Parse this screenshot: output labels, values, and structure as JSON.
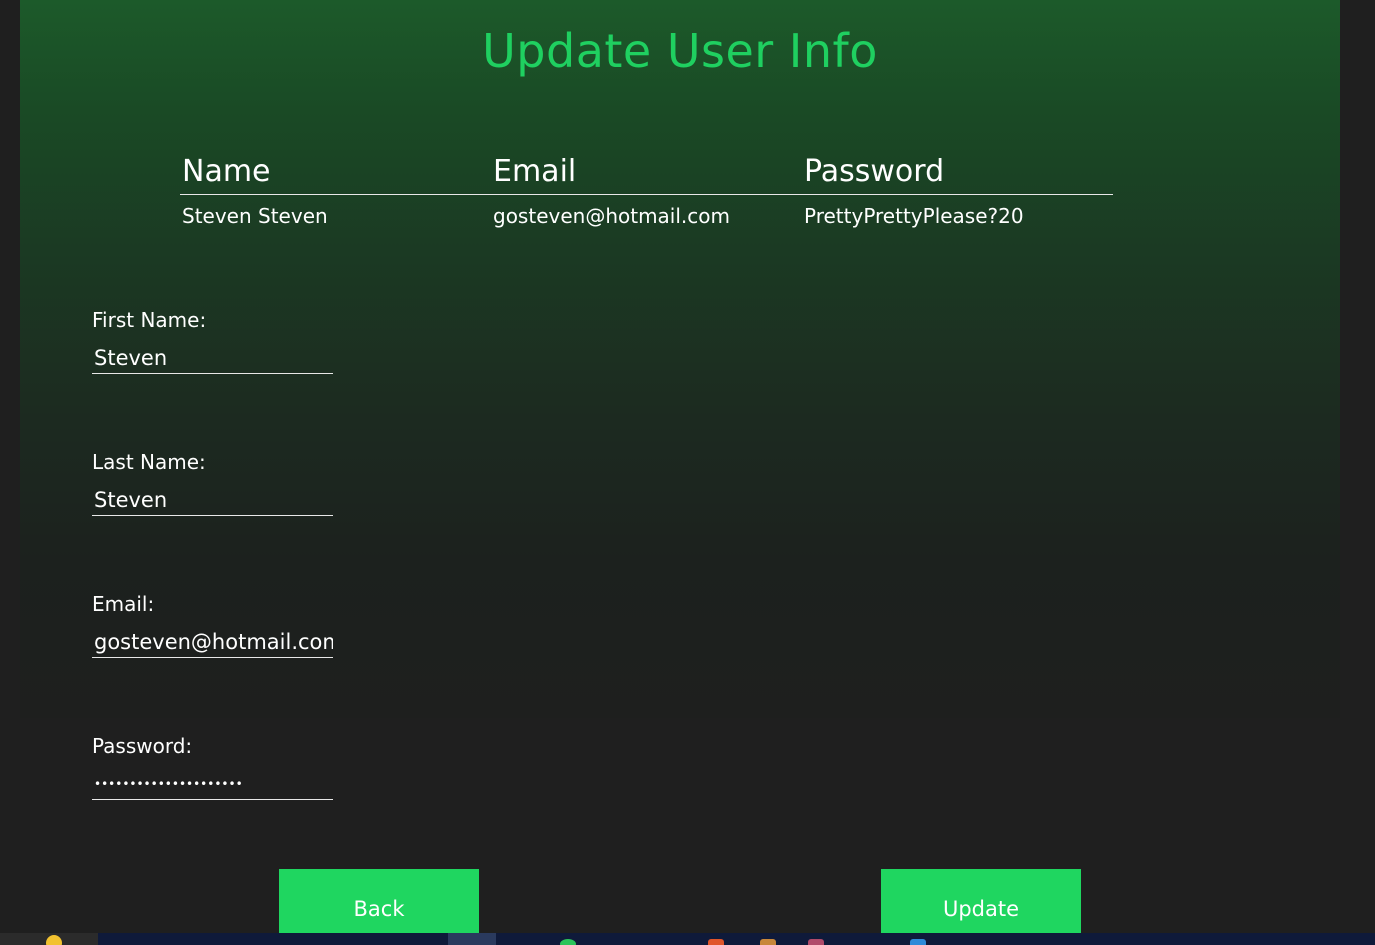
{
  "title": "Update User Info",
  "table": {
    "headers": [
      "Name",
      "Email",
      "Password"
    ],
    "rows": [
      [
        "Steven Steven",
        "gosteven@hotmail.com",
        "PrettyPrettyPlease?20"
      ]
    ]
  },
  "form": {
    "first_name": {
      "label": "First Name:",
      "value": "Steven"
    },
    "last_name": {
      "label": "Last Name:",
      "value": "Steven"
    },
    "email": {
      "label": "Email:",
      "value": "gosteven@hotmail.com"
    },
    "password": {
      "label": "Password:",
      "value": "PrettyPrettyPlease?20"
    }
  },
  "buttons": {
    "back": "Back",
    "update": "Update"
  },
  "colors": {
    "accent": "#1fd660",
    "title": "#1fd060",
    "background": "#1f1f1f"
  },
  "taskbar": {
    "icons": [
      "weather-icon",
      "app-icon",
      "app-icon",
      "chrome-icon",
      "app-icon",
      "app-icon",
      "app-icon",
      "app-icon",
      "app-icon"
    ]
  }
}
